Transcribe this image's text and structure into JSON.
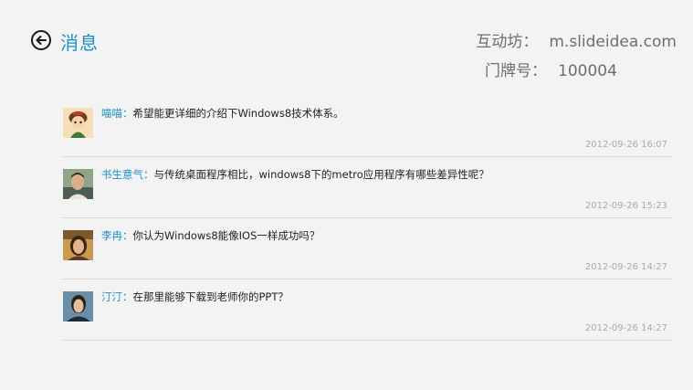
{
  "header": {
    "title": "消息",
    "back_icon": "back-arrow-circle-icon",
    "rows": [
      {
        "label": "互动坊：",
        "value": "m.slideidea.com"
      },
      {
        "label": "门牌号：",
        "value": "100004"
      }
    ]
  },
  "colors": {
    "accent": "#1b8fc4",
    "background": "#f3f3f3",
    "timestamp": "#aaaaaa"
  },
  "messages": [
    {
      "author": "喵喵：",
      "text": "希望能更详细的介绍下Windows8技术体系。",
      "time": "2012-09-26 16:07",
      "avatar": "cartoon-avatar"
    },
    {
      "author": "书生意气：",
      "text": "与传统桌面程序相比，windows8下的metro应用程序有哪些差异性呢？",
      "time": "2012-09-26 15:23",
      "avatar": "man-photo-avatar"
    },
    {
      "author": "李冉：",
      "text": "你认为Windows8能像IOS一样成功吗？",
      "time": "2012-09-26 14:27",
      "avatar": "woman-photo-avatar"
    },
    {
      "author": "汀汀：",
      "text": "在那里能够下载到老师你的PPT？",
      "time": "2012-09-26 14:27",
      "avatar": "person-photo-avatar"
    }
  ]
}
